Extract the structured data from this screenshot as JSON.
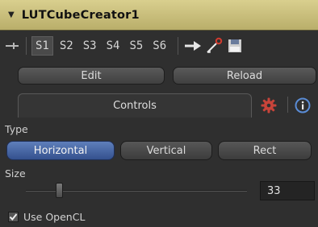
{
  "title_bar": {
    "title": "LUTCubeCreator1"
  },
  "toolbar": {
    "slots": [
      "S1",
      "S2",
      "S3",
      "S4",
      "S5",
      "S6"
    ],
    "active_slot": "S1",
    "icons": [
      "pin-icon",
      "insert-arrow-icon",
      "key-pick-icon",
      "save-icon"
    ]
  },
  "buttons": {
    "edit": "Edit",
    "reload": "Reload"
  },
  "tabs": {
    "controls": "Controls",
    "icons": [
      "settings-gear-icon",
      "info-icon"
    ]
  },
  "type": {
    "label": "Type",
    "options": [
      "Horizontal",
      "Vertical",
      "Rect"
    ],
    "selected": "Horizontal"
  },
  "size": {
    "label": "Size",
    "value": "33",
    "slider_fraction": 0.15
  },
  "use_opencl": {
    "label": "Use OpenCL",
    "checked": true
  },
  "colors": {
    "title_bar": "#d1c682",
    "selected_blue": "#4b6aa8",
    "panel_bg": "#2f2f2f",
    "gear_red": "#c8443a",
    "info_blue": "#5a8cd6"
  }
}
